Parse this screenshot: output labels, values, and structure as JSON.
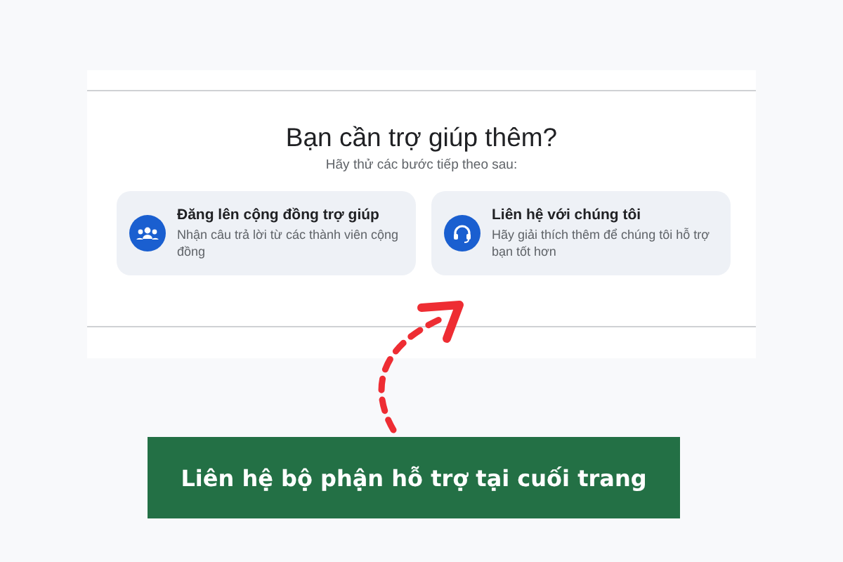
{
  "help": {
    "title": "Bạn cần trợ giúp thêm?",
    "subtitle": "Hãy thử các bước tiếp theo sau:",
    "cards": [
      {
        "kind": "community",
        "title": "Đăng lên cộng đồng trợ giúp",
        "description": "Nhận câu trả lời từ các thành viên cộng đồng"
      },
      {
        "kind": "contact",
        "title": "Liên hệ với chúng tôi",
        "description": "Hãy giải thích thêm để chúng tôi hỗ trợ bạn tốt hơn"
      }
    ]
  },
  "callout": {
    "text": "Liên hệ bộ phận hỗ trợ tại cuối trang"
  }
}
